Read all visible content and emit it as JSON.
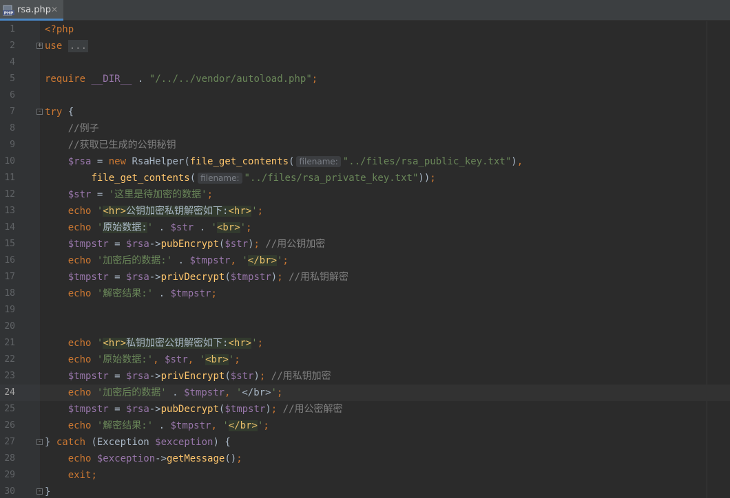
{
  "tab": {
    "filename": "rsa.php",
    "icon": "php-file-icon",
    "close_glyph": "✕"
  },
  "colors": {
    "background": "#2b2b2b",
    "keyword": "#cc7832",
    "string": "#6a8759",
    "variable": "#9876aa",
    "function": "#ffc66d",
    "comment": "#808080",
    "tab_accent": "#4a88c7"
  },
  "editor": {
    "current_line": 24,
    "lines": [
      {
        "n": "1",
        "tokens": [
          [
            "kw",
            "<?php"
          ]
        ]
      },
      {
        "n": "2",
        "fold": "+",
        "tokens": [
          [
            "kw",
            "use"
          ],
          [
            "plain",
            " "
          ],
          [
            "fold",
            "..."
          ]
        ]
      },
      {
        "n": "4",
        "tokens": []
      },
      {
        "n": "5",
        "tokens": [
          [
            "kw",
            "require"
          ],
          [
            "plain",
            " "
          ],
          [
            "var",
            "__DIR__"
          ],
          [
            "plain",
            " . "
          ],
          [
            "str",
            "\"/../../vendor/autoload.php\""
          ],
          [
            "kw",
            ";"
          ]
        ]
      },
      {
        "n": "6",
        "tokens": []
      },
      {
        "n": "7",
        "fold": "−",
        "tokens": [
          [
            "kw",
            "try"
          ],
          [
            "plain",
            " {"
          ]
        ]
      },
      {
        "n": "8",
        "tokens": [
          [
            "plain",
            "    "
          ],
          [
            "cm",
            "//例子"
          ]
        ]
      },
      {
        "n": "9",
        "tokens": [
          [
            "plain",
            "    "
          ],
          [
            "cm",
            "//获取已生成的公钥秘钥"
          ]
        ]
      },
      {
        "n": "10",
        "tokens": [
          [
            "plain",
            "    "
          ],
          [
            "var",
            "$rsa"
          ],
          [
            "plain",
            " = "
          ],
          [
            "kw",
            "new"
          ],
          [
            "plain",
            " RsaHelper("
          ],
          [
            "fn",
            "file_get_contents"
          ],
          [
            "plain",
            "("
          ],
          [
            "hint",
            "filename:"
          ],
          [
            "str",
            "\"../files/rsa_public_key.txt\""
          ],
          [
            "plain",
            ")"
          ],
          [
            "kw",
            ","
          ]
        ]
      },
      {
        "n": "11",
        "tokens": [
          [
            "plain",
            "        "
          ],
          [
            "fn",
            "file_get_contents"
          ],
          [
            "plain",
            "("
          ],
          [
            "hint",
            "filename:"
          ],
          [
            "str",
            "\"../files/rsa_private_key.txt\""
          ],
          [
            "plain",
            "))"
          ],
          [
            "kw",
            ";"
          ]
        ]
      },
      {
        "n": "12",
        "tokens": [
          [
            "plain",
            "    "
          ],
          [
            "var",
            "$str"
          ],
          [
            "plain",
            " = "
          ],
          [
            "str",
            "'这里是待加密的数据'"
          ],
          [
            "kw",
            ";"
          ]
        ]
      },
      {
        "n": "13",
        "tokens": [
          [
            "plain",
            "    "
          ],
          [
            "kw",
            "echo"
          ],
          [
            "plain",
            " "
          ],
          [
            "str",
            "'"
          ],
          [
            "tag",
            "<hr>"
          ],
          [
            "hl",
            "公钥加密私钥解密如下:"
          ],
          [
            "tag",
            "<hr>"
          ],
          [
            "str",
            "'"
          ],
          [
            "kw",
            ";"
          ]
        ]
      },
      {
        "n": "14",
        "tokens": [
          [
            "plain",
            "    "
          ],
          [
            "kw",
            "echo"
          ],
          [
            "plain",
            " "
          ],
          [
            "str",
            "'"
          ],
          [
            "hl",
            "原始数据:"
          ],
          [
            "str",
            "'"
          ],
          [
            "plain",
            " . "
          ],
          [
            "var",
            "$str"
          ],
          [
            "plain",
            " . "
          ],
          [
            "str",
            "'"
          ],
          [
            "tag",
            "<br>"
          ],
          [
            "str",
            "'"
          ],
          [
            "kw",
            ";"
          ]
        ]
      },
      {
        "n": "15",
        "tokens": [
          [
            "plain",
            "    "
          ],
          [
            "var",
            "$tmpstr"
          ],
          [
            "plain",
            " = "
          ],
          [
            "var",
            "$rsa"
          ],
          [
            "plain",
            "->"
          ],
          [
            "fn",
            "pubEncrypt"
          ],
          [
            "plain",
            "("
          ],
          [
            "var",
            "$str"
          ],
          [
            "plain",
            ")"
          ],
          [
            "kw",
            ";"
          ],
          [
            "plain",
            " "
          ],
          [
            "cm",
            "//用公钥加密"
          ]
        ]
      },
      {
        "n": "16",
        "tokens": [
          [
            "plain",
            "    "
          ],
          [
            "kw",
            "echo"
          ],
          [
            "plain",
            " "
          ],
          [
            "str",
            "'加密后的数据:'"
          ],
          [
            "plain",
            " . "
          ],
          [
            "var",
            "$tmpstr"
          ],
          [
            "kw",
            ","
          ],
          [
            "plain",
            " "
          ],
          [
            "str",
            "'"
          ],
          [
            "tag",
            "</br>"
          ],
          [
            "str",
            "'"
          ],
          [
            "kw",
            ";"
          ]
        ]
      },
      {
        "n": "17",
        "tokens": [
          [
            "plain",
            "    "
          ],
          [
            "var",
            "$tmpstr"
          ],
          [
            "plain",
            " = "
          ],
          [
            "var",
            "$rsa"
          ],
          [
            "plain",
            "->"
          ],
          [
            "fn",
            "privDecrypt"
          ],
          [
            "plain",
            "("
          ],
          [
            "var",
            "$tmpstr"
          ],
          [
            "plain",
            ")"
          ],
          [
            "kw",
            ";"
          ],
          [
            "plain",
            " "
          ],
          [
            "cm",
            "//用私钥解密"
          ]
        ]
      },
      {
        "n": "18",
        "tokens": [
          [
            "plain",
            "    "
          ],
          [
            "kw",
            "echo"
          ],
          [
            "plain",
            " "
          ],
          [
            "str",
            "'解密结果:'"
          ],
          [
            "plain",
            " . "
          ],
          [
            "var",
            "$tmpstr"
          ],
          [
            "kw",
            ";"
          ]
        ]
      },
      {
        "n": "19",
        "tokens": []
      },
      {
        "n": "20",
        "tokens": []
      },
      {
        "n": "21",
        "tokens": [
          [
            "plain",
            "    "
          ],
          [
            "kw",
            "echo"
          ],
          [
            "plain",
            " "
          ],
          [
            "str",
            "'"
          ],
          [
            "tag",
            "<hr>"
          ],
          [
            "hl",
            "私钥加密公钥解密如下:"
          ],
          [
            "tag",
            "<hr>"
          ],
          [
            "str",
            "'"
          ],
          [
            "kw",
            ";"
          ]
        ]
      },
      {
        "n": "22",
        "tokens": [
          [
            "plain",
            "    "
          ],
          [
            "kw",
            "echo"
          ],
          [
            "plain",
            " "
          ],
          [
            "str",
            "'原始数据:'"
          ],
          [
            "kw",
            ","
          ],
          [
            "plain",
            " "
          ],
          [
            "var",
            "$str"
          ],
          [
            "kw",
            ","
          ],
          [
            "plain",
            " "
          ],
          [
            "str",
            "'"
          ],
          [
            "tag",
            "<br>"
          ],
          [
            "str",
            "'"
          ],
          [
            "kw",
            ";"
          ]
        ]
      },
      {
        "n": "23",
        "tokens": [
          [
            "plain",
            "    "
          ],
          [
            "var",
            "$tmpstr"
          ],
          [
            "plain",
            " = "
          ],
          [
            "var",
            "$rsa"
          ],
          [
            "plain",
            "->"
          ],
          [
            "fn",
            "privEncrypt"
          ],
          [
            "plain",
            "("
          ],
          [
            "var",
            "$str"
          ],
          [
            "plain",
            ")"
          ],
          [
            "kw",
            ";"
          ],
          [
            "plain",
            " "
          ],
          [
            "cm",
            "//用私钥加密"
          ]
        ]
      },
      {
        "n": "24",
        "tokens": [
          [
            "plain",
            "    "
          ],
          [
            "kw",
            "echo"
          ],
          [
            "plain",
            " "
          ],
          [
            "str",
            "'加密后的数据'"
          ],
          [
            "plain",
            " . "
          ],
          [
            "var",
            "$tmpstr"
          ],
          [
            "kw",
            ","
          ],
          [
            "plain",
            " "
          ],
          [
            "str",
            "'"
          ],
          [
            "plain",
            "</br>"
          ],
          [
            "str",
            "'"
          ],
          [
            "kw",
            ";"
          ]
        ]
      },
      {
        "n": "25",
        "tokens": [
          [
            "plain",
            "    "
          ],
          [
            "var",
            "$tmpstr"
          ],
          [
            "plain",
            " = "
          ],
          [
            "var",
            "$rsa"
          ],
          [
            "plain",
            "->"
          ],
          [
            "fn",
            "pubDecrypt"
          ],
          [
            "plain",
            "("
          ],
          [
            "var",
            "$tmpstr"
          ],
          [
            "plain",
            ")"
          ],
          [
            "kw",
            ";"
          ],
          [
            "plain",
            " "
          ],
          [
            "cm",
            "//用公密解密"
          ]
        ]
      },
      {
        "n": "26",
        "tokens": [
          [
            "plain",
            "    "
          ],
          [
            "kw",
            "echo"
          ],
          [
            "plain",
            " "
          ],
          [
            "str",
            "'解密结果:'"
          ],
          [
            "plain",
            " . "
          ],
          [
            "var",
            "$tmpstr"
          ],
          [
            "kw",
            ","
          ],
          [
            "plain",
            " "
          ],
          [
            "str",
            "'"
          ],
          [
            "tag",
            "</br>"
          ],
          [
            "str",
            "'"
          ],
          [
            "kw",
            ";"
          ]
        ]
      },
      {
        "n": "27",
        "fold": "−",
        "tokens": [
          [
            "plain",
            "} "
          ],
          [
            "kw",
            "catch"
          ],
          [
            "plain",
            " (Exception "
          ],
          [
            "var",
            "$exception"
          ],
          [
            "plain",
            ") {"
          ]
        ]
      },
      {
        "n": "28",
        "tokens": [
          [
            "plain",
            "    "
          ],
          [
            "kw",
            "echo"
          ],
          [
            "plain",
            " "
          ],
          [
            "var",
            "$exception"
          ],
          [
            "plain",
            "->"
          ],
          [
            "fn",
            "getMessage"
          ],
          [
            "plain",
            "()"
          ],
          [
            "kw",
            ";"
          ]
        ]
      },
      {
        "n": "29",
        "tokens": [
          [
            "plain",
            "    "
          ],
          [
            "kw",
            "exit"
          ],
          [
            "kw",
            ";"
          ]
        ]
      },
      {
        "n": "30",
        "fold": "−",
        "tokens": [
          [
            "plain",
            "}"
          ]
        ]
      }
    ]
  }
}
